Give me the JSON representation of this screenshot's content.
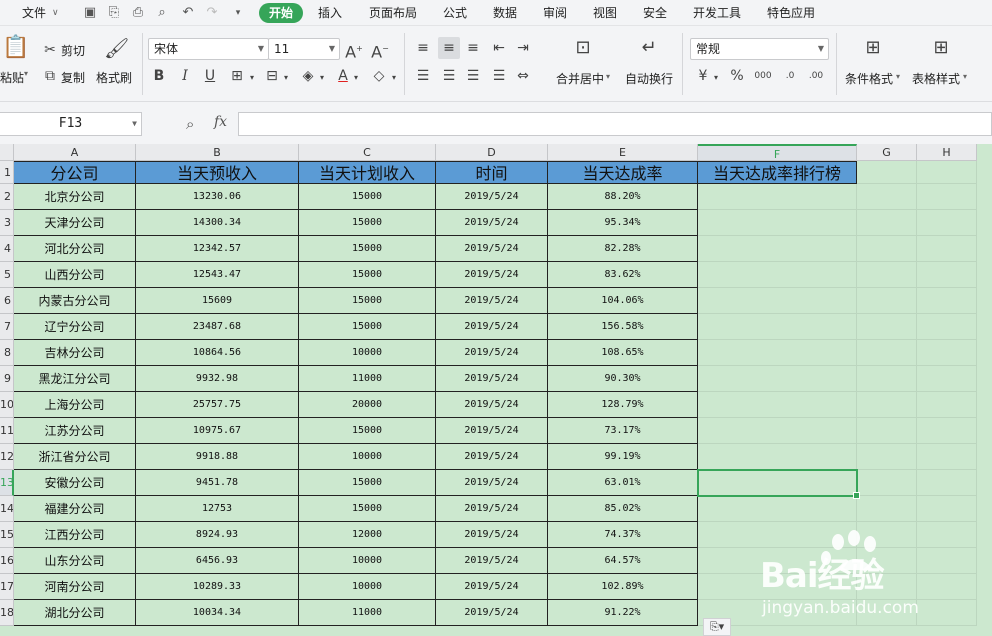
{
  "menubar": {
    "file": "文件",
    "tabs": [
      "开始",
      "插入",
      "页面布局",
      "公式",
      "数据",
      "审阅",
      "视图",
      "安全",
      "开发工具",
      "特色应用"
    ]
  },
  "ribbon": {
    "paste": "粘贴",
    "cut": "剪切",
    "copy": "复制",
    "format_painter": "格式刷",
    "font_name": "宋体",
    "font_size": "11",
    "merge_center": "合并居中",
    "wrap_text": "自动换行",
    "number_format": "常规",
    "conditional_format": "条件格式",
    "table_style": "表格样式"
  },
  "formula_bar": {
    "name_box": "F13",
    "fx": "fx",
    "value": ""
  },
  "columns": [
    "A",
    "B",
    "C",
    "D",
    "E",
    "F",
    "G",
    "H"
  ],
  "row_numbers": [
    "1",
    "2",
    "3",
    "4",
    "5",
    "6",
    "7",
    "8",
    "9",
    "10",
    "11",
    "12",
    "13",
    "14",
    "15",
    "16",
    "17",
    "18"
  ],
  "table": {
    "headers": [
      "分公司",
      "当天预收入",
      "当天计划收入",
      "时间",
      "当天达成率",
      "当天达成率排行榜"
    ],
    "rows": [
      [
        "北京分公司",
        "13230.06",
        "15000",
        "2019/5/24",
        "88.20%"
      ],
      [
        "天津分公司",
        "14300.34",
        "15000",
        "2019/5/24",
        "95.34%"
      ],
      [
        "河北分公司",
        "12342.57",
        "15000",
        "2019/5/24",
        "82.28%"
      ],
      [
        "山西分公司",
        "12543.47",
        "15000",
        "2019/5/24",
        "83.62%"
      ],
      [
        "内蒙古分公司",
        "15609",
        "15000",
        "2019/5/24",
        "104.06%"
      ],
      [
        "辽宁分公司",
        "23487.68",
        "15000",
        "2019/5/24",
        "156.58%"
      ],
      [
        "吉林分公司",
        "10864.56",
        "10000",
        "2019/5/24",
        "108.65%"
      ],
      [
        "黑龙江分公司",
        "9932.98",
        "11000",
        "2019/5/24",
        "90.30%"
      ],
      [
        "上海分公司",
        "25757.75",
        "20000",
        "2019/5/24",
        "128.79%"
      ],
      [
        "江苏分公司",
        "10975.67",
        "15000",
        "2019/5/24",
        "73.17%"
      ],
      [
        "浙江省分公司",
        "9918.88",
        "10000",
        "2019/5/24",
        "99.19%"
      ],
      [
        "安徽分公司",
        "9451.78",
        "15000",
        "2019/5/24",
        "63.01%"
      ],
      [
        "福建分公司",
        "12753",
        "15000",
        "2019/5/24",
        "85.02%"
      ],
      [
        "江西分公司",
        "8924.93",
        "12000",
        "2019/5/24",
        "74.37%"
      ],
      [
        "山东分公司",
        "6456.93",
        "10000",
        "2019/5/24",
        "64.57%"
      ],
      [
        "河南分公司",
        "10289.33",
        "10000",
        "2019/5/24",
        "102.89%"
      ],
      [
        "湖北分公司",
        "10034.34",
        "11000",
        "2019/5/24",
        "91.22%"
      ]
    ]
  },
  "selected_cell": "F13",
  "watermark": {
    "logo": "Bai经验",
    "url": "jingyan.baidu.com"
  },
  "colors": {
    "accent": "#36a559",
    "header_fill": "#5b9bd5",
    "sheet_bg": "#cce8cf"
  }
}
